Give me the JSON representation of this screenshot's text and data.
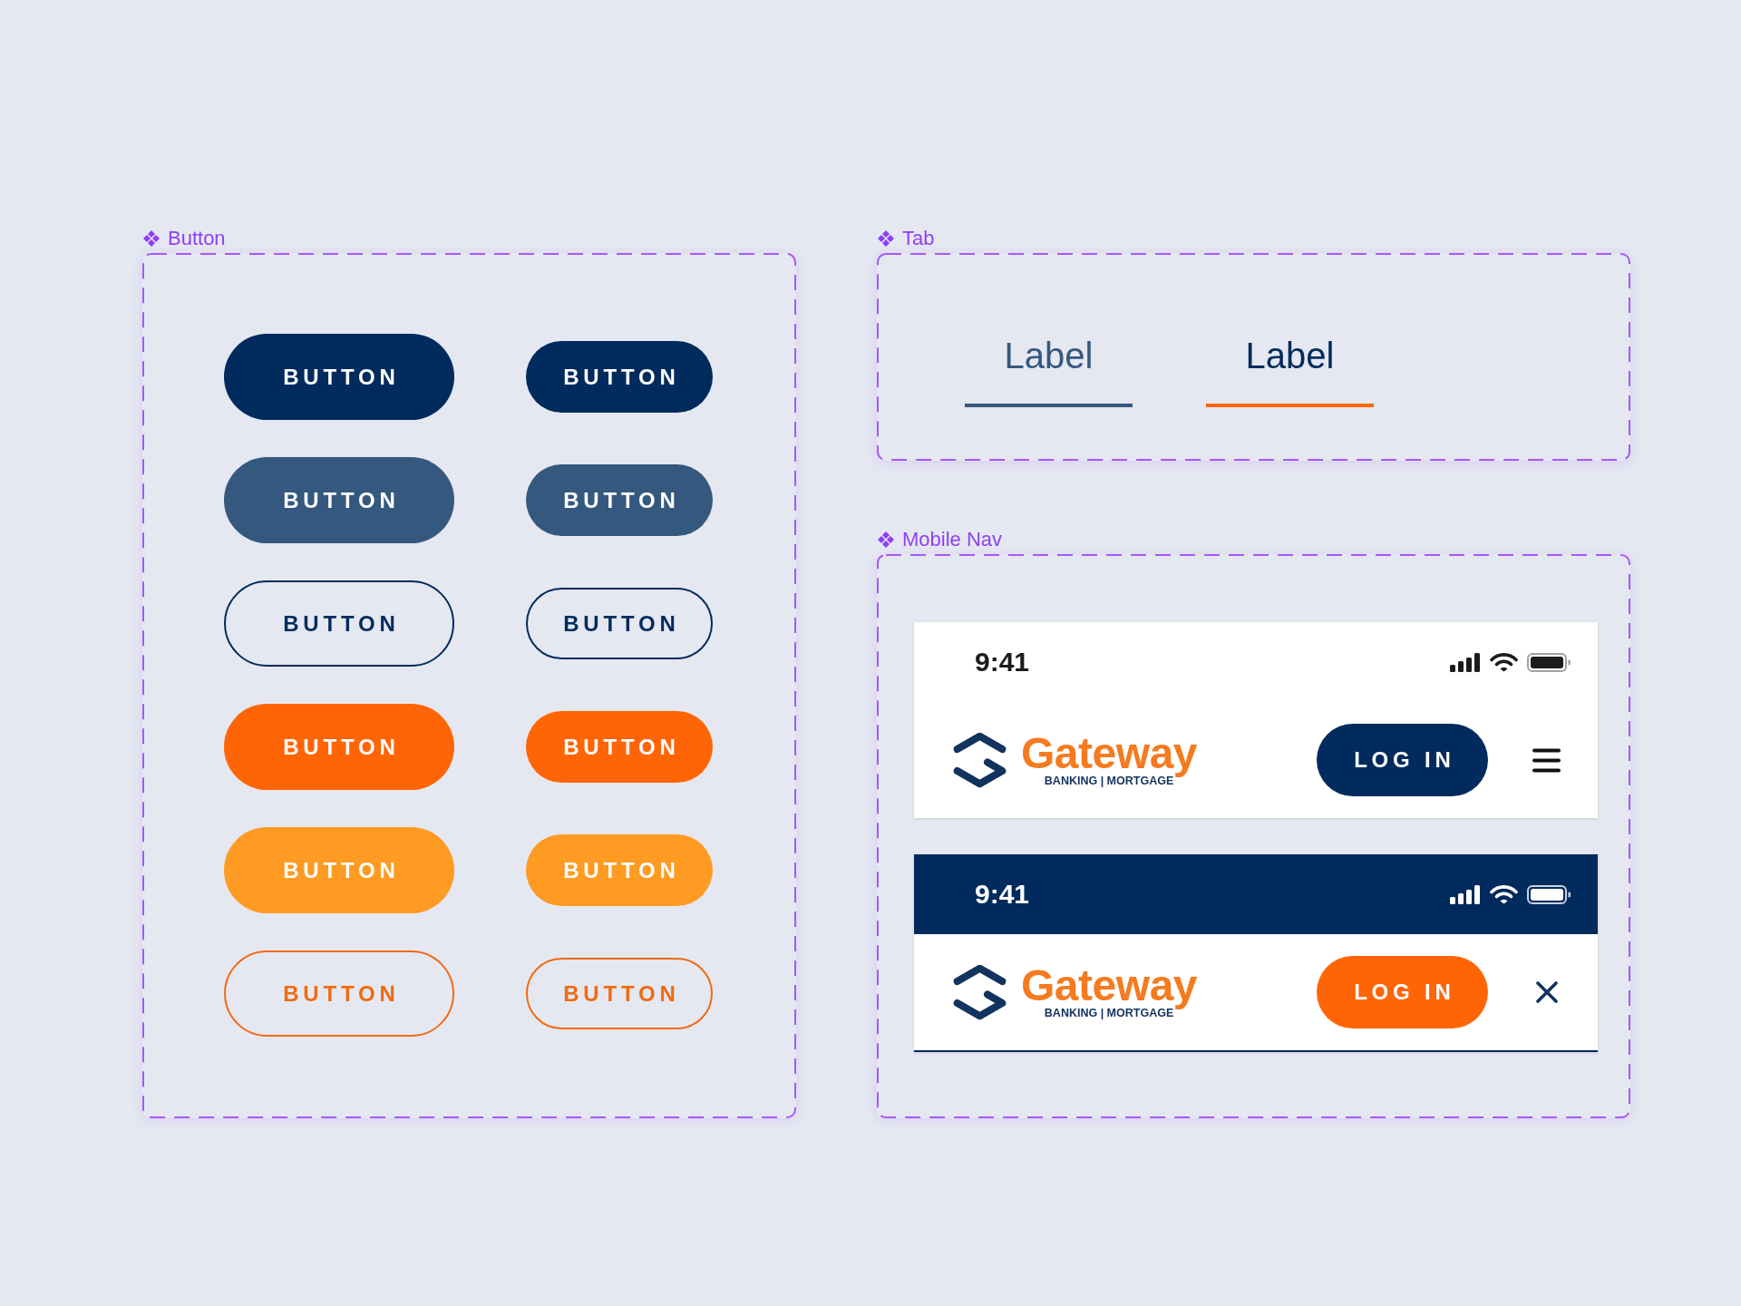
{
  "button_frame": {
    "label": "Button",
    "rows": [
      {
        "kind": "filled",
        "color": "#012b5d",
        "buttons": [
          {
            "label": "BUTTON",
            "kind": "large"
          },
          {
            "label": "BUTTON",
            "kind": "small"
          }
        ]
      },
      {
        "kind": "filled",
        "color": "#35587f",
        "buttons": [
          {
            "label": "BUTTON",
            "kind": "large"
          },
          {
            "label": "BUTTON",
            "kind": "small"
          }
        ]
      },
      {
        "kind": "outline",
        "color": "#012b5d",
        "buttons": [
          {
            "label": "BUTTON",
            "kind": "large"
          },
          {
            "label": "BUTTON",
            "kind": "small"
          }
        ]
      },
      {
        "kind": "filled",
        "color": "#ff6505",
        "buttons": [
          {
            "label": "BUTTON",
            "kind": "large"
          },
          {
            "label": "BUTTON",
            "kind": "small"
          }
        ]
      },
      {
        "kind": "filled",
        "color": "#ff9a22",
        "buttons": [
          {
            "label": "BUTTON",
            "kind": "large"
          },
          {
            "label": "BUTTON",
            "kind": "small"
          }
        ]
      },
      {
        "kind": "outline",
        "color": "#f26a10",
        "buttons": [
          {
            "label": "BUTTON",
            "kind": "large"
          },
          {
            "label": "BUTTON",
            "kind": "small"
          }
        ]
      }
    ]
  },
  "tab_frame": {
    "label": "Tab",
    "tabs": [
      {
        "label": "Label",
        "selected": false
      },
      {
        "label": "Label",
        "selected": true
      }
    ]
  },
  "mobile_nav_frame": {
    "label": "Mobile Nav",
    "navs": [
      {
        "status_bar": {
          "time": "9:41",
          "dark": false
        },
        "logo": {
          "name": "Gateway",
          "tagline": "BANKING | MORTGAGE"
        },
        "login_button": "LOG IN",
        "menu_open": false
      },
      {
        "status_bar": {
          "time": "9:41",
          "dark": true
        },
        "logo": {
          "name": "Gateway",
          "tagline": "BANKING | MORTGAGE"
        },
        "login_button": "LOG IN",
        "menu_open": true
      }
    ]
  }
}
